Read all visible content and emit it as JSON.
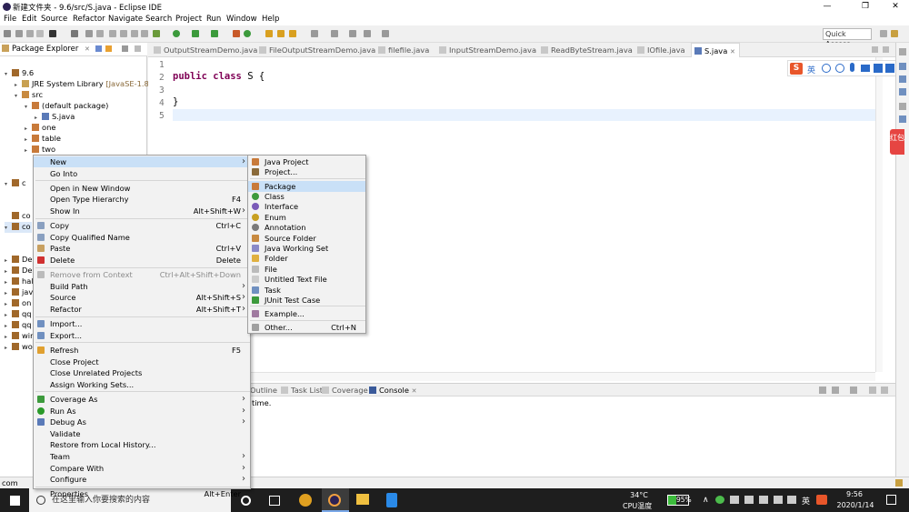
{
  "window": {
    "title": "新建文件夹 - 9.6/src/S.java - Eclipse IDE",
    "minimize_glyph": "—",
    "maximize_glyph": "❐",
    "close_glyph": "✕"
  },
  "menubar": [
    "File",
    "Edit",
    "Source",
    "Refactor",
    "Navigate",
    "Search",
    "Project",
    "Run",
    "Window",
    "Help"
  ],
  "toolbar": {
    "quick_access": "Quick Access"
  },
  "package_explorer": {
    "tab_label": "Package Explorer",
    "close_glyph": "✕",
    "tree": [
      {
        "label": "9.6",
        "twisty": "▾",
        "icon": "project-icon"
      },
      {
        "label": "JRE System Library",
        "suffix": "[JavaSE-1.8]",
        "twisty": "▸",
        "icon": "library-icon"
      },
      {
        "label": "src",
        "twisty": "▾",
        "icon": "source-folder-icon"
      },
      {
        "label": "(default package)",
        "twisty": "▾",
        "icon": "package-icon"
      },
      {
        "label": "S.java",
        "twisty": "▸",
        "icon": "java-file-icon"
      },
      {
        "label": "one",
        "twisty": "▸",
        "icon": "package-icon"
      },
      {
        "label": "table",
        "twisty": "▸",
        "icon": "package-icon"
      },
      {
        "label": "two",
        "twisty": "▸",
        "icon": "package-icon"
      }
    ],
    "partial_rows": [
      "c",
      "co",
      "co",
      "De",
      "De",
      "hal",
      "jav",
      "on",
      "qq",
      "qq",
      "wir",
      "wo"
    ]
  },
  "editor": {
    "tabs": [
      "OutputStreamDemo.java",
      "FileOutputStreamDemo.java",
      "filefile.java",
      "InputStreamDemo.java",
      "ReadByteStream.java",
      "IOfile.java",
      "S.java"
    ],
    "active_tab": "S.java",
    "line_numbers": [
      "1",
      "2",
      "3",
      "4",
      "5"
    ],
    "code": {
      "line2_kw1": "public",
      "line2_kw2": "class",
      "line2_rest": " S {",
      "line4": "}"
    }
  },
  "console": {
    "tabs": [
      "Outline",
      "Task List",
      "Coverage",
      "Console"
    ],
    "active_tab": "Console",
    "text": "time."
  },
  "status_bar": {
    "text": "com"
  },
  "red_packet": {
    "text": "红包"
  },
  "ime_bar": {
    "logo": "S",
    "mode": "英"
  },
  "context_menu": {
    "items": [
      {
        "label": "New",
        "submenu": true,
        "highlighted": true
      },
      {
        "label": "Go Into"
      },
      {
        "sep": true
      },
      {
        "label": "Open in New Window"
      },
      {
        "label": "Open Type Hierarchy",
        "accel": "F4"
      },
      {
        "label": "Show In",
        "accel": "Alt+Shift+W",
        "submenu": true
      },
      {
        "sep": true
      },
      {
        "label": "Copy",
        "accel": "Ctrl+C",
        "icon": "copy-icon"
      },
      {
        "label": "Copy Qualified Name",
        "icon": "copy-icon"
      },
      {
        "label": "Paste",
        "accel": "Ctrl+V",
        "icon": "paste-icon"
      },
      {
        "label": "Delete",
        "accel": "Delete",
        "icon": "delete-icon"
      },
      {
        "sep": true
      },
      {
        "label": "Remove from Context",
        "accel": "Ctrl+Alt+Shift+Down",
        "disabled": true,
        "icon": "remove-icon"
      },
      {
        "label": "Build Path",
        "submenu": true
      },
      {
        "label": "Source",
        "accel": "Alt+Shift+S",
        "submenu": true
      },
      {
        "label": "Refactor",
        "accel": "Alt+Shift+T",
        "submenu": true
      },
      {
        "sep": true
      },
      {
        "label": "Import...",
        "icon": "import-icon"
      },
      {
        "label": "Export...",
        "icon": "export-icon"
      },
      {
        "sep": true
      },
      {
        "label": "Refresh",
        "accel": "F5",
        "icon": "refresh-icon"
      },
      {
        "label": "Close Project"
      },
      {
        "label": "Close Unrelated Projects"
      },
      {
        "label": "Assign Working Sets..."
      },
      {
        "sep": true
      },
      {
        "label": "Coverage As",
        "submenu": true,
        "icon": "coverage-icon"
      },
      {
        "label": "Run As",
        "submenu": true,
        "icon": "run-icon"
      },
      {
        "label": "Debug As",
        "submenu": true,
        "icon": "debug-icon"
      },
      {
        "label": "Validate"
      },
      {
        "label": "Restore from Local History..."
      },
      {
        "label": "Team",
        "submenu": true
      },
      {
        "label": "Compare With",
        "submenu": true
      },
      {
        "label": "Configure",
        "submenu": true
      },
      {
        "sep": true
      },
      {
        "label": "Properties",
        "accel": "Alt+Enter"
      }
    ]
  },
  "submenu_new": {
    "items": [
      {
        "label": "Java Project",
        "icon": "java-project-icon"
      },
      {
        "label": "Project...",
        "icon": "project-icon"
      },
      {
        "sep": true
      },
      {
        "label": "Package",
        "icon": "package-icon",
        "highlighted": true
      },
      {
        "label": "Class",
        "icon": "class-icon"
      },
      {
        "label": "Interface",
        "icon": "interface-icon"
      },
      {
        "label": "Enum",
        "icon": "enum-icon"
      },
      {
        "label": "Annotation",
        "icon": "annotation-icon"
      },
      {
        "label": "Source Folder",
        "icon": "source-folder-icon"
      },
      {
        "label": "Java Working Set",
        "icon": "working-set-icon"
      },
      {
        "label": "Folder",
        "icon": "folder-icon"
      },
      {
        "label": "File",
        "icon": "file-icon"
      },
      {
        "label": "Untitled Text File",
        "icon": "text-file-icon"
      },
      {
        "label": "Task",
        "icon": "task-icon"
      },
      {
        "label": "JUnit Test Case",
        "icon": "junit-icon"
      },
      {
        "sep": true
      },
      {
        "label": "Example...",
        "icon": "example-icon"
      },
      {
        "sep": true
      },
      {
        "label": "Other...",
        "accel": "Ctrl+N",
        "icon": "other-icon"
      }
    ]
  },
  "taskbar": {
    "search_placeholder": "在这里输入你要搜索的内容",
    "temperature": "34°C",
    "temp_label": "CPU温度",
    "battery": "95%",
    "ime": "英",
    "time": "9:56",
    "date": "2020/1/14"
  },
  "colors": {
    "highlight": "#c9e0f7",
    "keyword": "#7f0055",
    "current_line": "#e8f2fe",
    "red_packet": "#e64542"
  }
}
